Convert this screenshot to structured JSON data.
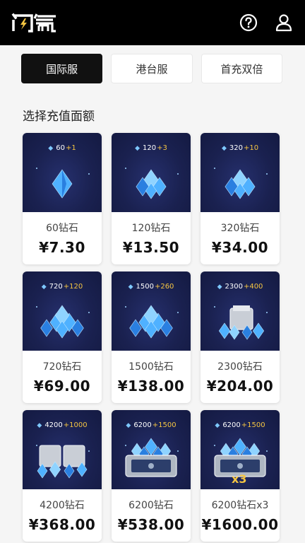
{
  "header": {
    "logo": "闪氪",
    "help_icon": "question-circle-icon",
    "user_icon": "user-icon"
  },
  "tabs": [
    {
      "label": "国际服",
      "active": true
    },
    {
      "label": "港台服",
      "active": false
    },
    {
      "label": "首充双倍",
      "active": false
    }
  ],
  "section_title": "选择充值面额",
  "colors": {
    "topbar": "#000000",
    "card_art_bg": "#1a2150",
    "bonus_plus": "#f5c542",
    "gem_blue": "#4fb1ff"
  },
  "products": [
    {
      "base": "60",
      "bonus": "+1",
      "name": "60钻石",
      "price": "¥7.30",
      "art": "single-gem-icon"
    },
    {
      "base": "120",
      "bonus": "+3",
      "name": "120钻石",
      "price": "¥13.50",
      "art": "gem-pile-small-icon"
    },
    {
      "base": "320",
      "bonus": "+10",
      "name": "320钻石",
      "price": "¥34.00",
      "art": "gem-pile-small-icon"
    },
    {
      "base": "720",
      "bonus": "+120",
      "name": "720钻石",
      "price": "¥69.00",
      "art": "gem-pile-medium-icon"
    },
    {
      "base": "1500",
      "bonus": "+260",
      "name": "1500钻石",
      "price": "¥138.00",
      "art": "gem-pile-medium-icon"
    },
    {
      "base": "2300",
      "bonus": "+400",
      "name": "2300钻石",
      "price": "¥204.00",
      "art": "gem-box-icon"
    },
    {
      "base": "4200",
      "bonus": "+1000",
      "name": "4200钻石",
      "price": "¥368.00",
      "art": "gem-boxes-icon"
    },
    {
      "base": "6200",
      "bonus": "+1500",
      "name": "6200钻石",
      "price": "¥538.00",
      "art": "gem-chest-icon"
    },
    {
      "base": "6200",
      "bonus": "+1500",
      "name": "6200钻石x3",
      "price": "¥1600.00",
      "art": "gem-chest-icon",
      "multiplier": "x3"
    }
  ]
}
